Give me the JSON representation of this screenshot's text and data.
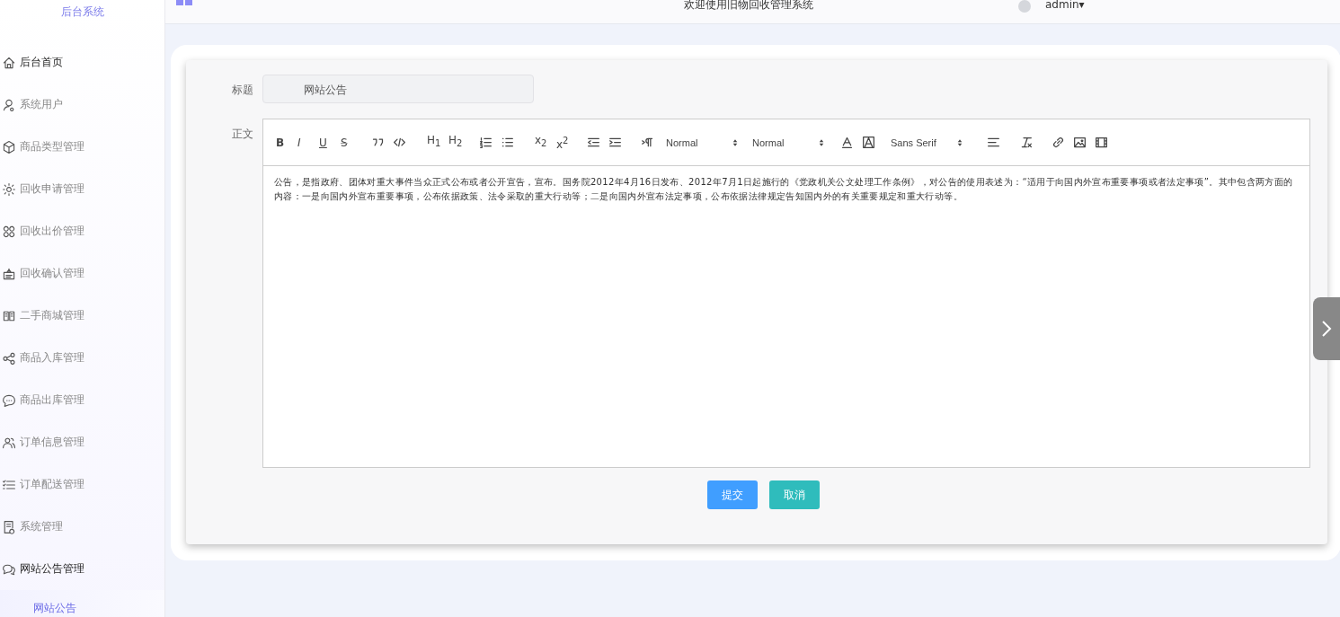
{
  "sidebar": {
    "title": "后台系统",
    "items": [
      {
        "label": "后台首页",
        "active": true
      },
      {
        "label": "系统用户",
        "active": false
      },
      {
        "label": "商品类型管理",
        "active": false
      },
      {
        "label": "回收申请管理",
        "active": false
      },
      {
        "label": "回收出价管理",
        "active": false
      },
      {
        "label": "回收确认管理",
        "active": false
      },
      {
        "label": "二手商城管理",
        "active": false
      },
      {
        "label": "商品入库管理",
        "active": false
      },
      {
        "label": "商品出库管理",
        "active": false
      },
      {
        "label": "订单信息管理",
        "active": false
      },
      {
        "label": "订单配送管理",
        "active": false
      },
      {
        "label": "系统管理",
        "active": false
      },
      {
        "label": "网站公告管理",
        "active": true,
        "children": [
          {
            "label": "网站公告",
            "selected": true
          }
        ]
      }
    ]
  },
  "header": {
    "greeting": "欢迎使用旧物回收管理系统",
    "user": "admin",
    "user_caret": "▾"
  },
  "form": {
    "title_label": "标题",
    "title_value": "网站公告",
    "body_label": "正文",
    "toolbar": [
      {
        "kind": "glyph",
        "text": "B"
      },
      {
        "kind": "glyph",
        "text": "I"
      },
      {
        "kind": "glyph",
        "text": "U"
      },
      {
        "kind": "glyph",
        "text": "S"
      },
      {
        "kind": "icon"
      },
      {
        "kind": "icon"
      },
      {
        "kind": "glyph",
        "text": "H$_{1}$"
      },
      {
        "kind": "glyph",
        "text": "H$_{2}$"
      },
      {
        "kind": "icon"
      },
      {
        "kind": "icon"
      },
      {
        "kind": "glyph",
        "text": "x$_{2}$"
      },
      {
        "kind": "glyph",
        "text": "x$^{2}$"
      },
      {
        "kind": "icon"
      },
      {
        "kind": "icon"
      },
      {
        "kind": "icon"
      },
      {
        "kind": "picker",
        "text": "Normal"
      },
      {
        "kind": "picker",
        "text": "Normal"
      },
      {
        "kind": "icon"
      },
      {
        "kind": "icon"
      },
      {
        "kind": "picker",
        "text": "Sans Serif"
      },
      {
        "kind": "icon"
      },
      {
        "kind": "icon"
      },
      {
        "kind": "icon"
      },
      {
        "kind": "icon"
      },
      {
        "kind": "icon"
      }
    ],
    "body": "公告，是指政府、团体对重大事件当众正式公布或者公开宣告，宣布。国务院2012年4月16日发布、2012年7月1日起施行的《党政机关公文处理工作条例》，对公告的使用表述为：“适用于向国内外宣布重要事项或者法定事项”。其中包含两方面的内容：一是向国内外宣布重要事项，公布依据政策、法令采取的重大行动等；二是向国内外宣布法定事项，公布依据法律规定告知国内外的有关重要规定和重大行动等。",
    "buttons": [
      {
        "label": "提交",
        "kind": "primary"
      },
      {
        "label": "取消",
        "kind": "secondary"
      }
    ]
  }
}
